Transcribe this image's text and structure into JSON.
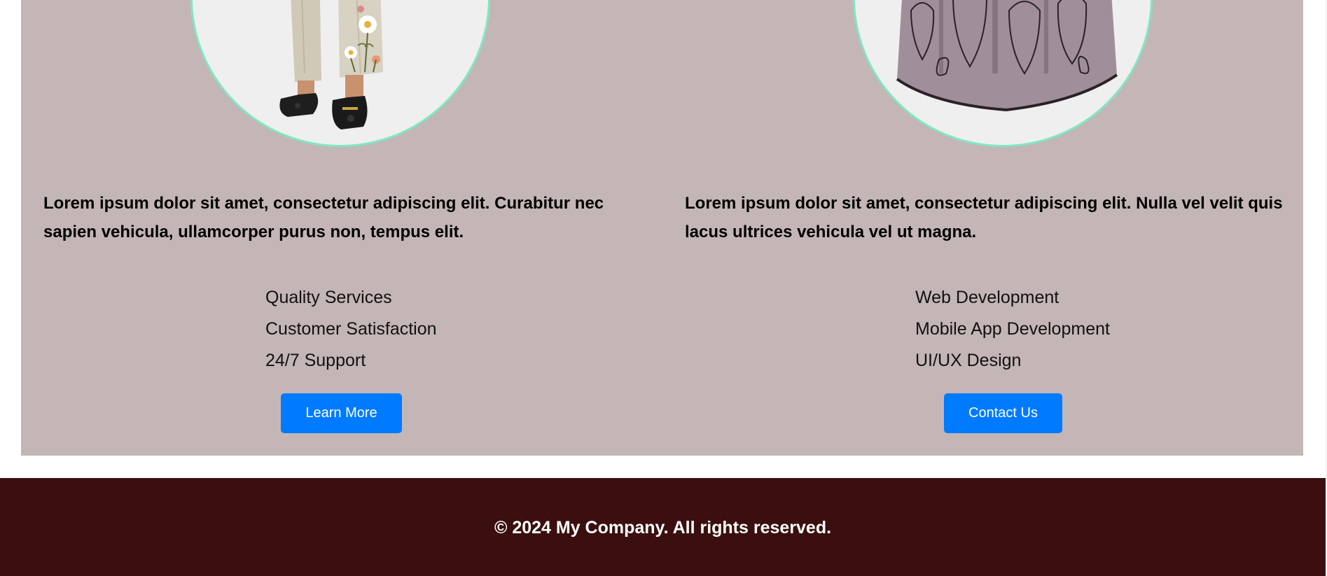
{
  "cards": [
    {
      "image": "cropped product photo: cream linen trousers with floral embroidery, black loafers",
      "description": "Lorem ipsum dolor sit amet, consectetur adipiscing elit. Curabitur nec sapien vehicula, ullamcorper purus non, tempus elit.",
      "features": [
        "Quality Services",
        "Customer Satisfaction",
        "24/7 Support"
      ],
      "button_label": "Learn More"
    },
    {
      "image": "cropped product photo: mauve dress with black cat line-art print",
      "description": "Lorem ipsum dolor sit amet, consectetur adipiscing elit. Nulla vel velit quis lacus ultrices vehicula vel ut magna.",
      "features": [
        "Web Development",
        "Mobile App Development",
        "UI/UX Design"
      ],
      "button_label": "Contact Us"
    }
  ],
  "footer": {
    "text": "© 2024 My Company. All rights reserved."
  },
  "colors": {
    "section_bg": "#c4b6b6",
    "circle_border": "#7fe8c4",
    "button_bg": "#007bff",
    "footer_bg": "#3b0f0f"
  }
}
